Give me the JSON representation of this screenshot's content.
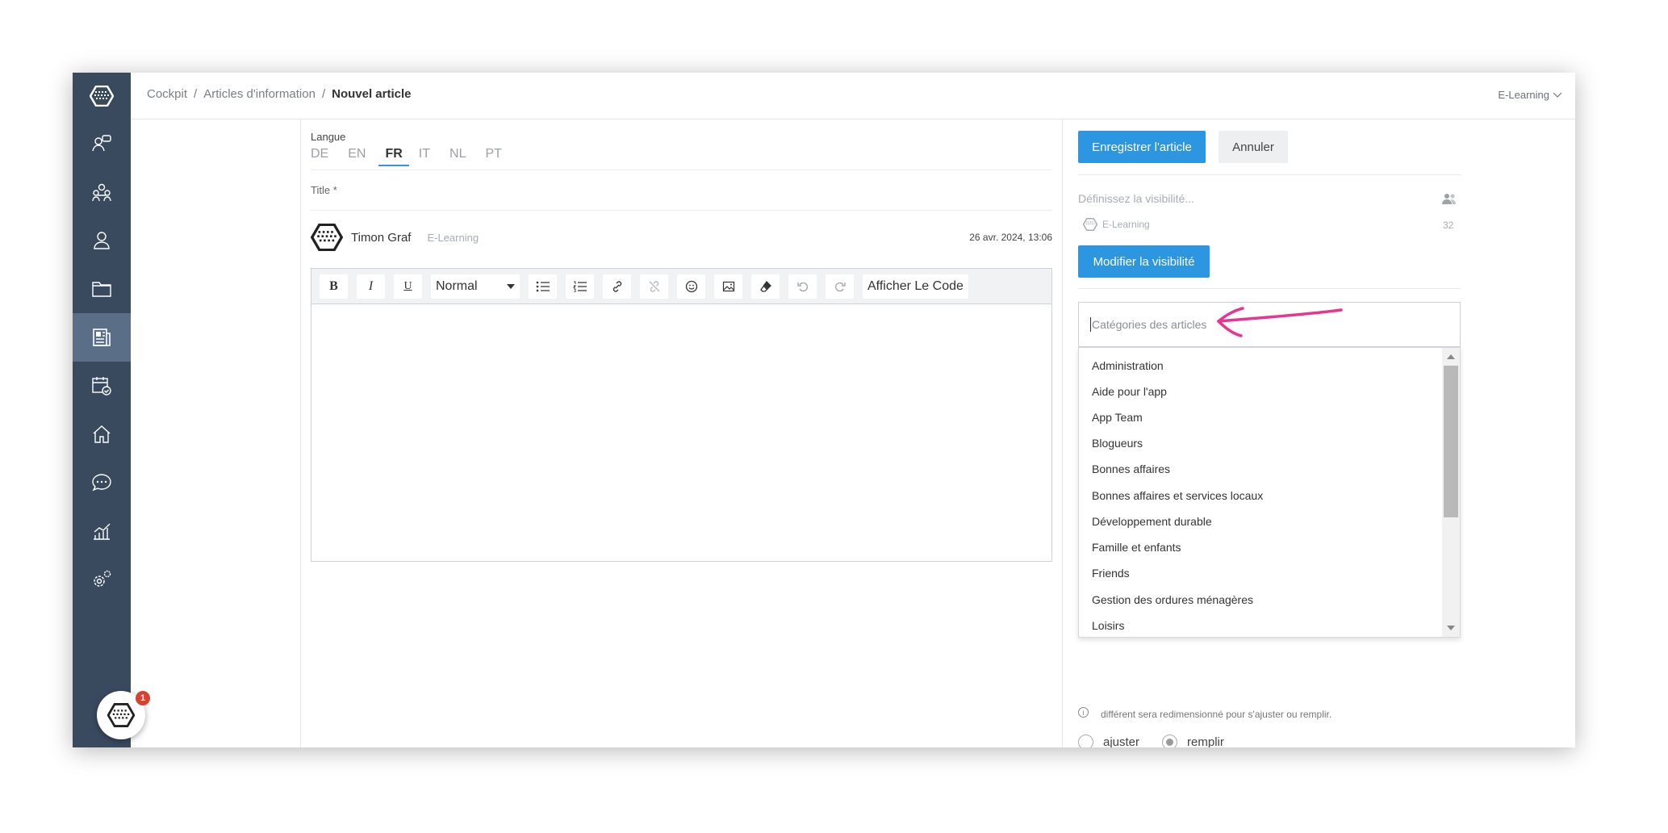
{
  "breadcrumb": {
    "root": "Cockpit",
    "section": "Articles d'information",
    "current": "Nouvel article"
  },
  "tenant": {
    "label": "E-Learning"
  },
  "sidebar": {
    "icons": [
      "feedback-icon",
      "group-icon",
      "user-icon",
      "folder-icon",
      "newspaper-icon",
      "calendar-check-icon",
      "home-icon",
      "chat-icon",
      "analytics-icon",
      "settings-icon"
    ],
    "active": "newspaper-icon",
    "accent": "#3a4a5e"
  },
  "language": {
    "label": "Langue",
    "tabs": [
      "DE",
      "EN",
      "FR",
      "IT",
      "NL",
      "PT"
    ],
    "active": "FR",
    "accent": "#3a95e0"
  },
  "title_field": {
    "label": "Title *"
  },
  "author": {
    "name": "Timon Graf",
    "tag": "E-Learning",
    "date": "26 avr. 2024, 13:06"
  },
  "editor": {
    "format": "Normal",
    "code_button": "Afficher Le Code"
  },
  "actions": {
    "save": "Enregistrer l'article",
    "cancel": "Annuler",
    "primary_color": "#2d96e0"
  },
  "visibility": {
    "placeholder": "Définissez la visibilité...",
    "group": "E-Learning",
    "count": "32",
    "modify": "Modifier la visibilité"
  },
  "categories": {
    "placeholder": "Catégories des articles",
    "options": [
      "Administration",
      "Aide pour l'app",
      "App Team",
      "Blogueurs",
      "Bonnes affaires",
      "Bonnes affaires et services locaux",
      "Développement durable",
      "Famille et enfants",
      "Friends",
      "Gestion des ordures ménagères",
      "Loisirs"
    ]
  },
  "image_note": {
    "text": "différent sera redimensionné pour s'ajuster ou remplir."
  },
  "fit": {
    "options": [
      "ajuster",
      "remplir"
    ],
    "selected": "remplir"
  },
  "chat": {
    "badge": "1"
  }
}
